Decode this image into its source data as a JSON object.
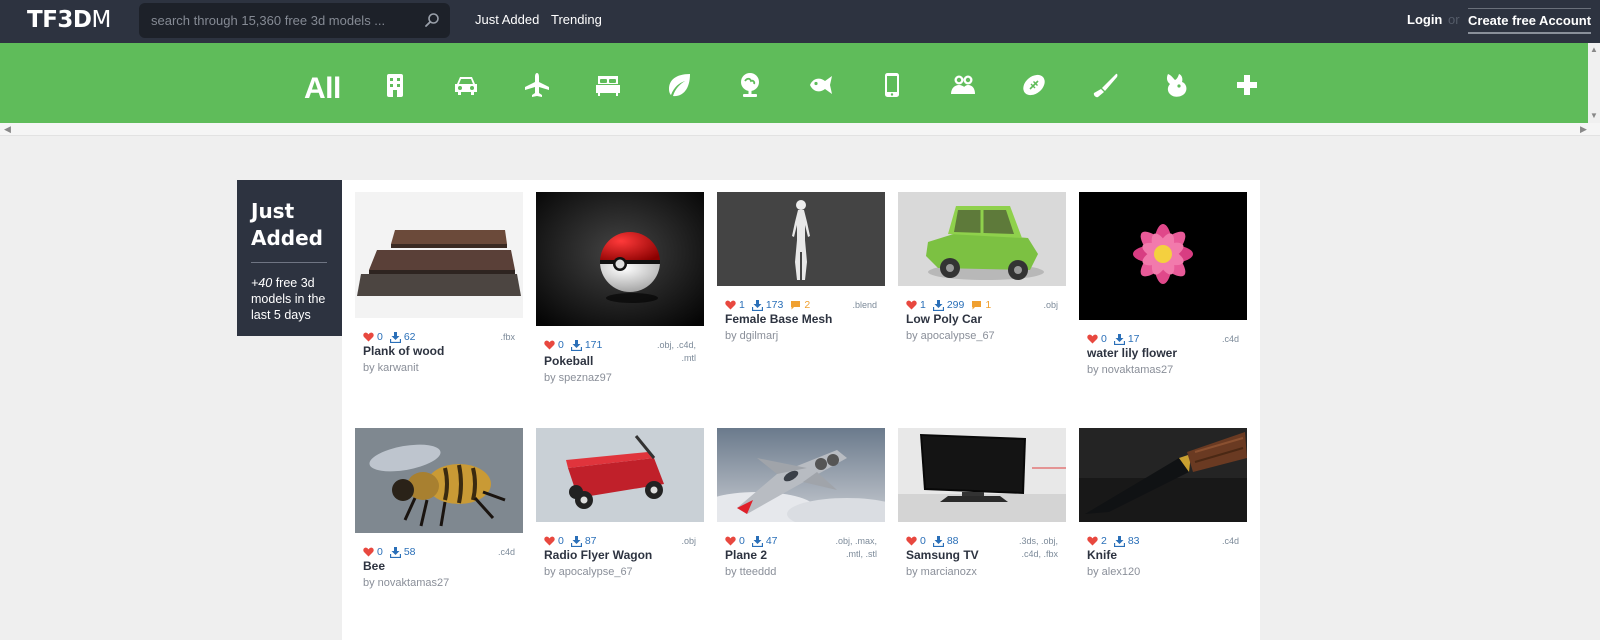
{
  "header": {
    "logo_main": "TF3D",
    "logo_end": "M",
    "search_placeholder": "search through 15,360 free 3d models ...",
    "nav_just_added": "Just Added",
    "nav_trending": "Trending",
    "login": "Login",
    "or": "or",
    "create_account": "Create free Account"
  },
  "categories": {
    "all_label": "All",
    "icons": [
      "building-icon",
      "car-icon",
      "airplane-icon",
      "furniture-icon",
      "leaf-icon",
      "tree-icon",
      "fish-icon",
      "phone-icon",
      "people-icon",
      "football-icon",
      "knife-icon",
      "animal-icon",
      "plus-icon"
    ]
  },
  "sidebar": {
    "title_line1": "Just",
    "title_line2": "Added",
    "count": "+40",
    "desc": " free 3d models in the last 5 days"
  },
  "models": [
    {
      "name": "Plank of wood",
      "author": "by karwanit",
      "likes": "0",
      "downloads": "62",
      "comments": "",
      "formats": ".fbx"
    },
    {
      "name": "Pokeball",
      "author": "by speznaz97",
      "likes": "0",
      "downloads": "171",
      "comments": "",
      "formats": ".obj, .c4d, .mtl"
    },
    {
      "name": "Female Base Mesh",
      "author": "by dgilmarj",
      "likes": "1",
      "downloads": "173",
      "comments": "2",
      "formats": ".blend"
    },
    {
      "name": "Low Poly Car",
      "author": "by apocalypse_67",
      "likes": "1",
      "downloads": "299",
      "comments": "1",
      "formats": ".obj"
    },
    {
      "name": "water lily flower",
      "author": "by novaktamas27",
      "likes": "0",
      "downloads": "17",
      "comments": "",
      "formats": ".c4d"
    },
    {
      "name": "Bee",
      "author": "by novaktamas27",
      "likes": "0",
      "downloads": "58",
      "comments": "",
      "formats": ".c4d"
    },
    {
      "name": "Radio Flyer Wagon",
      "author": "by apocalypse_67",
      "likes": "0",
      "downloads": "87",
      "comments": "",
      "formats": ".obj"
    },
    {
      "name": "Plane 2",
      "author": "by tteeddd",
      "likes": "0",
      "downloads": "47",
      "comments": "",
      "formats": ".obj, .max, .mtl, .stl"
    },
    {
      "name": "Samsung TV",
      "author": "by marcianozx",
      "likes": "0",
      "downloads": "88",
      "comments": "",
      "formats": ".3ds, .obj, .c4d, .fbx"
    },
    {
      "name": "Knife",
      "author": "by alex120",
      "likes": "2",
      "downloads": "83",
      "comments": "",
      "formats": ".c4d"
    }
  ]
}
